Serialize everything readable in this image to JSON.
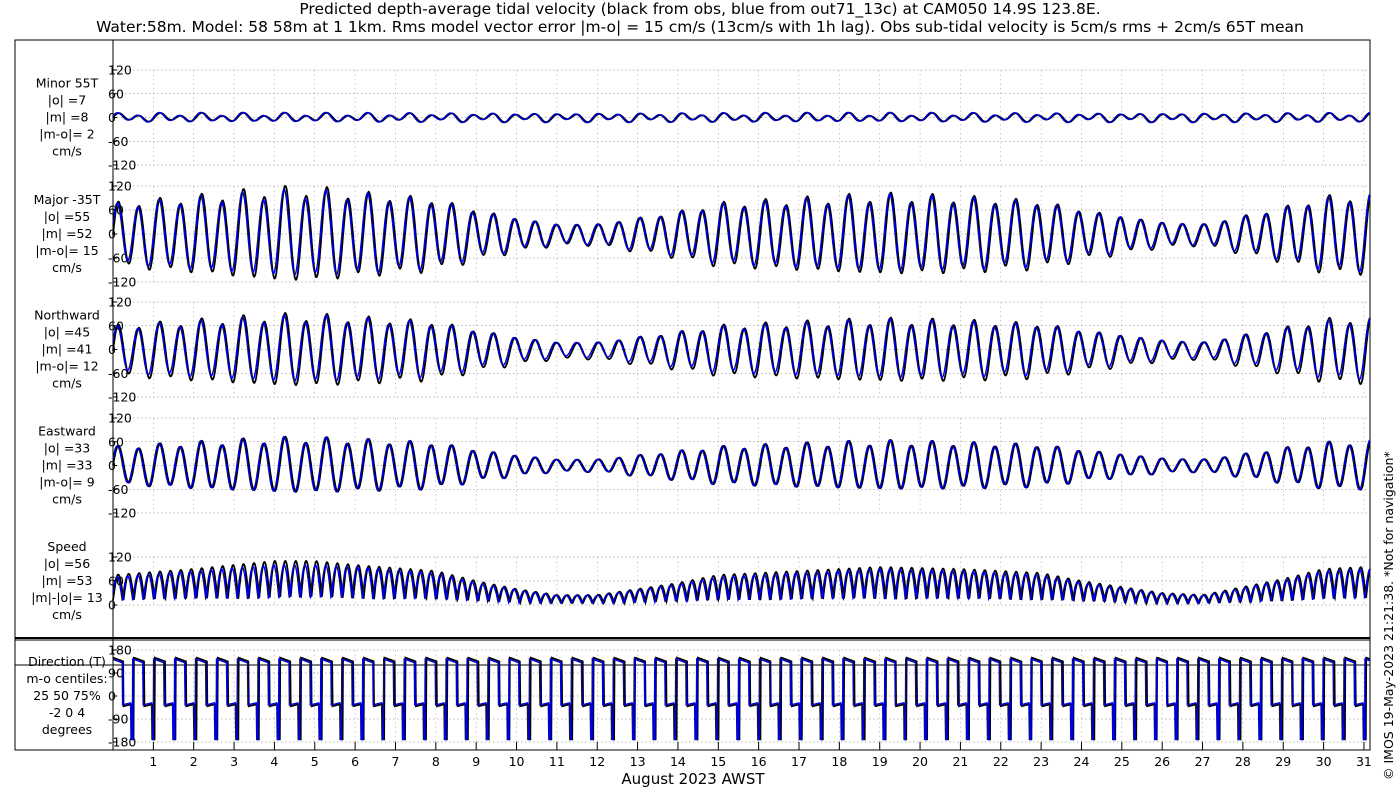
{
  "title_line1": "Predicted depth-average tidal velocity (black from obs, blue from out71_13c) at CAM050 14.9S 123.8E.",
  "title_line2": "Water:58m. Model: 58 58m at 1 1km. Rms model vector error |m-o| = 15 cm/s (13cm/s with 1h lag). Obs sub-tidal velocity is 5cm/s rms + 2cm/s 65T mean",
  "credit": "© IMOS 19-May-2023 21:21:38.  *Not for navigation*",
  "xlabel": "August 2023 AWST",
  "x_ticks": [
    "1",
    "2",
    "3",
    "4",
    "5",
    "6",
    "7",
    "8",
    "9",
    "10",
    "11",
    "12",
    "13",
    "14",
    "15",
    "16",
    "17",
    "18",
    "19",
    "20",
    "21",
    "22",
    "23",
    "24",
    "25",
    "26",
    "27",
    "28",
    "29",
    "30",
    "31"
  ],
  "colors": {
    "obs": "#000000",
    "model": "#0000dd"
  },
  "chart_data": [
    {
      "type": "line",
      "panel": "minor",
      "labels": [
        "Minor 55T",
        "|o| =7",
        "|m| =8",
        "|m-o|= 2",
        "cm/s"
      ],
      "ylim": [
        -120,
        120
      ],
      "yticks": [
        "120",
        "60",
        "0",
        "-60",
        "-120"
      ],
      "x_range_days": [
        0,
        31.15
      ],
      "series": [
        {
          "name": "obs",
          "mode": "tidal",
          "semidiurnal_amp": 8,
          "diurnal_amp": 4,
          "offset": 0
        },
        {
          "name": "model",
          "mode": "tidal",
          "semidiurnal_amp": 9,
          "diurnal_amp": 4,
          "offset": 0
        }
      ]
    },
    {
      "type": "line",
      "panel": "major",
      "labels": [
        "Major -35T",
        "|o| =55",
        "|m| =52",
        "|m-o|= 15",
        "cm/s"
      ],
      "ylim": [
        -120,
        120
      ],
      "yticks": [
        "120",
        "60",
        "0",
        "-60",
        "-120"
      ],
      "x_range_days": [
        0,
        31.15
      ],
      "series": [
        {
          "name": "obs",
          "mode": "tidal",
          "envelope": [
            [
              0,
              75
            ],
            [
              2,
              90
            ],
            [
              4,
              110
            ],
            [
              5,
              110
            ],
            [
              6,
              100
            ],
            [
              8,
              85
            ],
            [
              9,
              60
            ],
            [
              10,
              40
            ],
            [
              11,
              25
            ],
            [
              12,
              25
            ],
            [
              13,
              40
            ],
            [
              14,
              55
            ],
            [
              15,
              75
            ],
            [
              17,
              85
            ],
            [
              19,
              95
            ],
            [
              21,
              90
            ],
            [
              23,
              80
            ],
            [
              24,
              60
            ],
            [
              25,
              45
            ],
            [
              26,
              30
            ],
            [
              27,
              25
            ],
            [
              28,
              45
            ],
            [
              29,
              65
            ],
            [
              30,
              90
            ],
            [
              31,
              95
            ]
          ],
          "offset": -2
        },
        {
          "name": "model",
          "mode": "tidal",
          "envelope": [
            [
              0,
              70
            ],
            [
              2,
              85
            ],
            [
              4,
              100
            ],
            [
              5,
              100
            ],
            [
              6,
              95
            ],
            [
              8,
              80
            ],
            [
              9,
              55
            ],
            [
              10,
              38
            ],
            [
              11,
              24
            ],
            [
              12,
              24
            ],
            [
              13,
              38
            ],
            [
              14,
              52
            ],
            [
              15,
              70
            ],
            [
              17,
              80
            ],
            [
              19,
              90
            ],
            [
              21,
              85
            ],
            [
              23,
              75
            ],
            [
              24,
              56
            ],
            [
              25,
              42
            ],
            [
              26,
              28
            ],
            [
              27,
              24
            ],
            [
              28,
              42
            ],
            [
              29,
              62
            ],
            [
              30,
              85
            ],
            [
              31,
              90
            ]
          ],
          "offset": 0
        }
      ]
    },
    {
      "type": "line",
      "panel": "northward",
      "labels": [
        "Northward",
        "|o| =45",
        "|m| =41",
        "|m-o|= 12",
        "cm/s"
      ],
      "ylim": [
        -120,
        120
      ],
      "yticks": [
        "120",
        "60",
        "0",
        "-60",
        "-120"
      ],
      "x_range_days": [
        0,
        31.15
      ],
      "series": [
        {
          "name": "obs",
          "mode": "tidal",
          "envelope": [
            [
              0,
              60
            ],
            [
              2,
              72
            ],
            [
              4,
              85
            ],
            [
              5,
              85
            ],
            [
              6,
              80
            ],
            [
              8,
              70
            ],
            [
              9,
              50
            ],
            [
              10,
              33
            ],
            [
              11,
              20
            ],
            [
              12,
              20
            ],
            [
              13,
              33
            ],
            [
              14,
              45
            ],
            [
              15,
              60
            ],
            [
              17,
              68
            ],
            [
              19,
              75
            ],
            [
              21,
              72
            ],
            [
              23,
              65
            ],
            [
              24,
              50
            ],
            [
              25,
              38
            ],
            [
              26,
              25
            ],
            [
              27,
              20
            ],
            [
              28,
              38
            ],
            [
              29,
              55
            ],
            [
              30,
              75
            ],
            [
              31,
              80
            ]
          ],
          "offset": -3
        },
        {
          "name": "model",
          "mode": "tidal",
          "envelope": [
            [
              0,
              55
            ],
            [
              2,
              66
            ],
            [
              4,
              78
            ],
            [
              5,
              78
            ],
            [
              6,
              74
            ],
            [
              8,
              64
            ],
            [
              9,
              46
            ],
            [
              10,
              30
            ],
            [
              11,
              18
            ],
            [
              12,
              18
            ],
            [
              13,
              30
            ],
            [
              14,
              42
            ],
            [
              15,
              55
            ],
            [
              17,
              62
            ],
            [
              19,
              70
            ],
            [
              21,
              66
            ],
            [
              23,
              60
            ],
            [
              24,
              46
            ],
            [
              25,
              35
            ],
            [
              26,
              23
            ],
            [
              27,
              18
            ],
            [
              28,
              35
            ],
            [
              29,
              50
            ],
            [
              30,
              68
            ],
            [
              31,
              72
            ]
          ],
          "offset": 0
        }
      ]
    },
    {
      "type": "line",
      "panel": "eastward",
      "labels": [
        "Eastward",
        "|o| =33",
        "|m| =33",
        "|m-o|= 9",
        "cm/s"
      ],
      "ylim": [
        -120,
        120
      ],
      "yticks": [
        "120",
        "60",
        "0",
        "-60",
        "-120"
      ],
      "x_range_days": [
        0,
        31.15
      ],
      "series": [
        {
          "name": "obs",
          "mode": "tidal",
          "envelope": [
            [
              0,
              45
            ],
            [
              2,
              55
            ],
            [
              4,
              65
            ],
            [
              5,
              65
            ],
            [
              6,
              62
            ],
            [
              8,
              55
            ],
            [
              9,
              38
            ],
            [
              10,
              25
            ],
            [
              11,
              15
            ],
            [
              12,
              15
            ],
            [
              13,
              25
            ],
            [
              14,
              35
            ],
            [
              15,
              45
            ],
            [
              17,
              52
            ],
            [
              19,
              58
            ],
            [
              21,
              55
            ],
            [
              23,
              50
            ],
            [
              24,
              38
            ],
            [
              25,
              28
            ],
            [
              26,
              18
            ],
            [
              27,
              15
            ],
            [
              28,
              28
            ],
            [
              29,
              42
            ],
            [
              30,
              55
            ],
            [
              31,
              58
            ]
          ],
          "offset": 0
        },
        {
          "name": "model",
          "mode": "tidal",
          "envelope": [
            [
              0,
              45
            ],
            [
              2,
              55
            ],
            [
              4,
              65
            ],
            [
              5,
              65
            ],
            [
              6,
              62
            ],
            [
              8,
              55
            ],
            [
              9,
              38
            ],
            [
              10,
              25
            ],
            [
              11,
              15
            ],
            [
              12,
              15
            ],
            [
              13,
              25
            ],
            [
              14,
              35
            ],
            [
              15,
              45
            ],
            [
              17,
              52
            ],
            [
              19,
              58
            ],
            [
              21,
              55
            ],
            [
              23,
              50
            ],
            [
              24,
              38
            ],
            [
              25,
              28
            ],
            [
              26,
              18
            ],
            [
              27,
              15
            ],
            [
              28,
              28
            ],
            [
              29,
              42
            ],
            [
              30,
              55
            ],
            [
              31,
              58
            ]
          ],
          "offset": 0
        }
      ]
    },
    {
      "type": "line",
      "panel": "speed",
      "labels": [
        "Speed",
        "|o| =56",
        "|m| =53",
        "|m|-|o|= 13",
        "cm/s"
      ],
      "ylim": [
        0,
        120
      ],
      "yticks": [
        "120",
        "60",
        "0"
      ],
      "x_range_days": [
        0,
        31.15
      ],
      "series": [
        {
          "name": "obs",
          "mode": "speed",
          "envelope": [
            [
              0,
              75
            ],
            [
              2,
              90
            ],
            [
              4,
              110
            ],
            [
              5,
              110
            ],
            [
              6,
              100
            ],
            [
              8,
              85
            ],
            [
              9,
              60
            ],
            [
              10,
              40
            ],
            [
              11,
              25
            ],
            [
              12,
              25
            ],
            [
              13,
              40
            ],
            [
              14,
              55
            ],
            [
              15,
              75
            ],
            [
              17,
              85
            ],
            [
              19,
              95
            ],
            [
              21,
              90
            ],
            [
              23,
              80
            ],
            [
              24,
              60
            ],
            [
              25,
              45
            ],
            [
              26,
              30
            ],
            [
              27,
              25
            ],
            [
              28,
              45
            ],
            [
              29,
              65
            ],
            [
              30,
              90
            ],
            [
              31,
              95
            ]
          ],
          "offset": 0
        },
        {
          "name": "model",
          "mode": "speed",
          "envelope": [
            [
              0,
              70
            ],
            [
              2,
              85
            ],
            [
              4,
              100
            ],
            [
              5,
              100
            ],
            [
              6,
              95
            ],
            [
              8,
              80
            ],
            [
              9,
              55
            ],
            [
              10,
              38
            ],
            [
              11,
              24
            ],
            [
              12,
              24
            ],
            [
              13,
              38
            ],
            [
              14,
              52
            ],
            [
              15,
              70
            ],
            [
              17,
              80
            ],
            [
              19,
              90
            ],
            [
              21,
              85
            ],
            [
              23,
              75
            ],
            [
              24,
              56
            ],
            [
              25,
              42
            ],
            [
              26,
              28
            ],
            [
              27,
              24
            ],
            [
              28,
              42
            ],
            [
              29,
              62
            ],
            [
              30,
              85
            ],
            [
              31,
              90
            ]
          ],
          "offset": 0
        }
      ]
    },
    {
      "type": "line",
      "panel": "direction",
      "labels": [
        "Direction (T)",
        "m-o centiles:",
        "25  50  75%",
        "-2  0  4",
        "degrees"
      ],
      "ylim": [
        -180,
        180
      ],
      "yticks": [
        "180",
        "90",
        "0",
        "-90",
        "-180"
      ],
      "x_range_days": [
        0,
        31.15
      ],
      "series": [
        {
          "name": "obs",
          "mode": "direction",
          "high_deg": 150,
          "low_deg": -40
        },
        {
          "name": "model",
          "mode": "direction",
          "high_deg": 145,
          "low_deg": -35
        }
      ]
    }
  ]
}
